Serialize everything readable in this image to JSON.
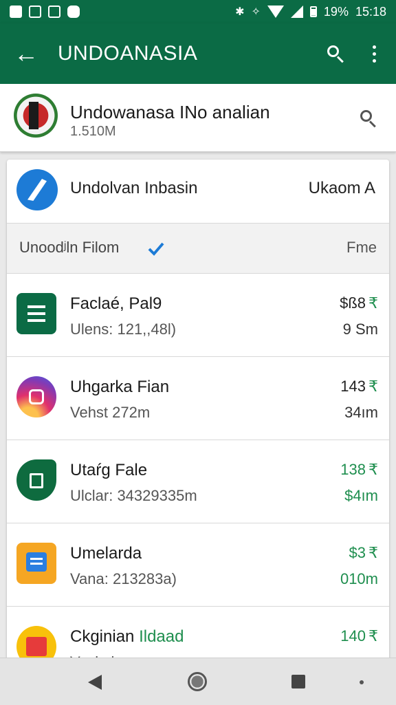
{
  "status_bar": {
    "battery_text": "19%",
    "time": "15:18",
    "icons": [
      "gallery-icon",
      "screenshot-icon",
      "photo-icon",
      "chat-icon",
      "bluetooth-icon",
      "vibrate-icon",
      "wifi-icon",
      "signal-icon",
      "battery-icon"
    ]
  },
  "app_bar": {
    "title": "UNDOANASIA",
    "icons": [
      "back-arrow-icon",
      "search-icon",
      "more-vertical-icon"
    ]
  },
  "profile": {
    "name": "Undowanasa INo analian",
    "subtitle": "1.510M"
  },
  "card": {
    "head_title": "Undolvan Inbasin",
    "head_right": "Ukaom A",
    "section_title": "Unoodʲln Filom",
    "section_right": "Fme",
    "rows": [
      {
        "name": "Faclaé, Pal9",
        "sub": "Ulens: 121,,48l)",
        "price": "$ß8",
        "currency": "₹",
        "meta": "9 Sm",
        "price_green": false,
        "meta_green": false
      },
      {
        "name": "Uhgarka Fian",
        "sub": "Vehst 272m",
        "price": "143",
        "currency": "₹",
        "meta": "34ım",
        "price_green": false,
        "meta_green": false
      },
      {
        "name": "Utaŕg Fale",
        "sub": "Ulclar: 34329335m",
        "price": "138",
        "currency": "₹",
        "meta": "$4ım",
        "price_green": true,
        "meta_green": true
      },
      {
        "name": "Umelarda",
        "sub": "Vana: 213283a)",
        "price": "$3",
        "currency": "₹",
        "meta": "010m",
        "price_green": true,
        "meta_green": true
      },
      {
        "name": "Ckginian Ildaad",
        "sub": "Vaskai",
        "price": "140",
        "currency": "₹",
        "meta": "",
        "price_green": true,
        "meta_green": false
      }
    ]
  },
  "colors": {
    "primary": "#0b6b45",
    "accent_green": "#1e8e4e",
    "verified_blue": "#1d7bd6"
  }
}
